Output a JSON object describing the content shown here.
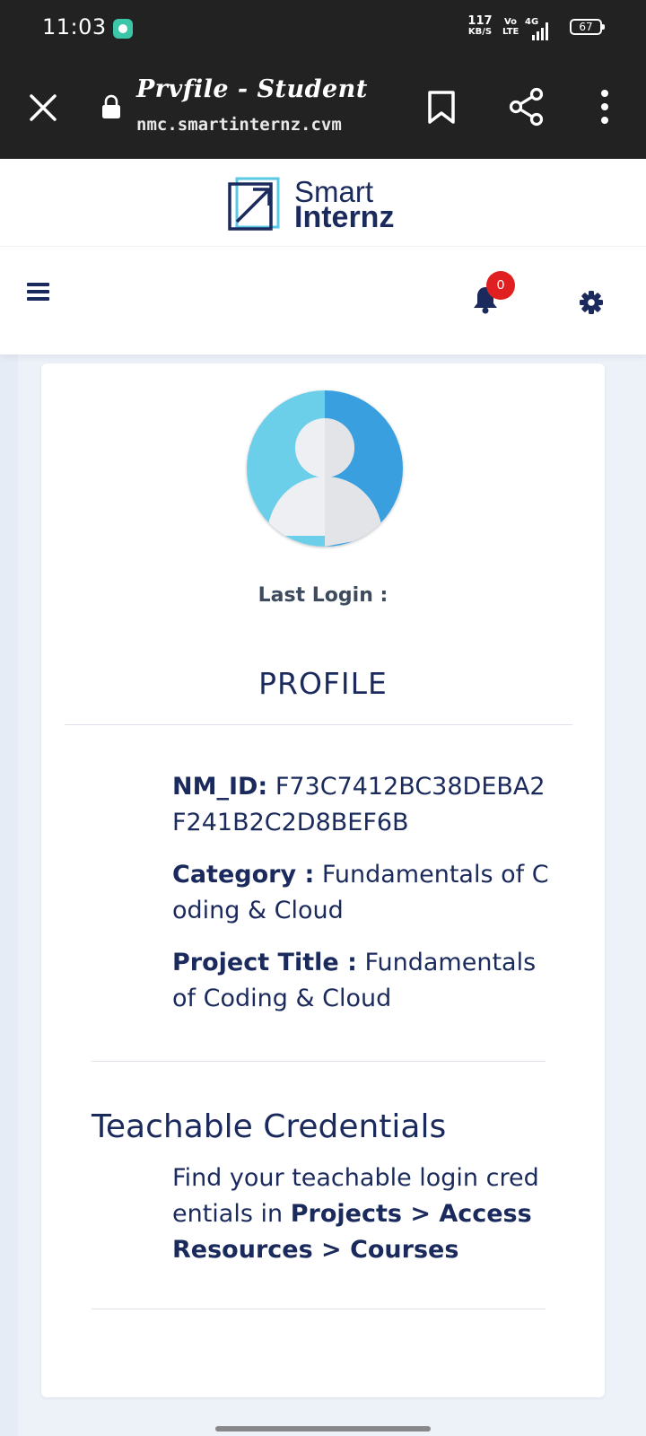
{
  "status_bar": {
    "time": "11:03",
    "net_speed_value": "117",
    "net_speed_unit": "KB/S",
    "volte_top": "Vo",
    "volte_bottom": "LTE",
    "network_type": "4G",
    "battery": "67",
    "icons": [
      "app-notification-icon",
      "signal-icon",
      "battery-icon"
    ]
  },
  "browser": {
    "title": "Prvfile - Student",
    "url": "nmc.smartinternz.cvm",
    "icons": [
      "close-icon",
      "lock-icon",
      "bookmark-icon",
      "share-icon",
      "more-vertical-icon"
    ]
  },
  "site": {
    "logo_word_1": "Smart",
    "logo_word_2": "Internz",
    "notification_count": "0",
    "icons": [
      "menu-icon",
      "bell-icon",
      "gear-icon"
    ]
  },
  "profile": {
    "last_login_label": "Last Login :",
    "heading": "PROFILE",
    "nm_id_label": "NM_ID:",
    "nm_id_value": "F73C7412BC38DEBA2F241B2C2D8BEF6B",
    "category_label": "Category :",
    "category_value": "Fundamentals of Coding & Cloud",
    "project_title_label": "Project Title :",
    "project_title_value": "Fundamentals of Coding & Cloud"
  },
  "credentials": {
    "heading": "Teachable Credentials",
    "text_prefix": "Find your teachable login credentials in ",
    "text_path": "Projects > Access Resources > Courses"
  },
  "colors": {
    "primary": "#1b2a5c",
    "badge": "#e02020",
    "chrome": "#222222",
    "page_bg": "#edf1f8",
    "avatar_left": "#6bcfea",
    "avatar_right": "#3a9fde"
  }
}
